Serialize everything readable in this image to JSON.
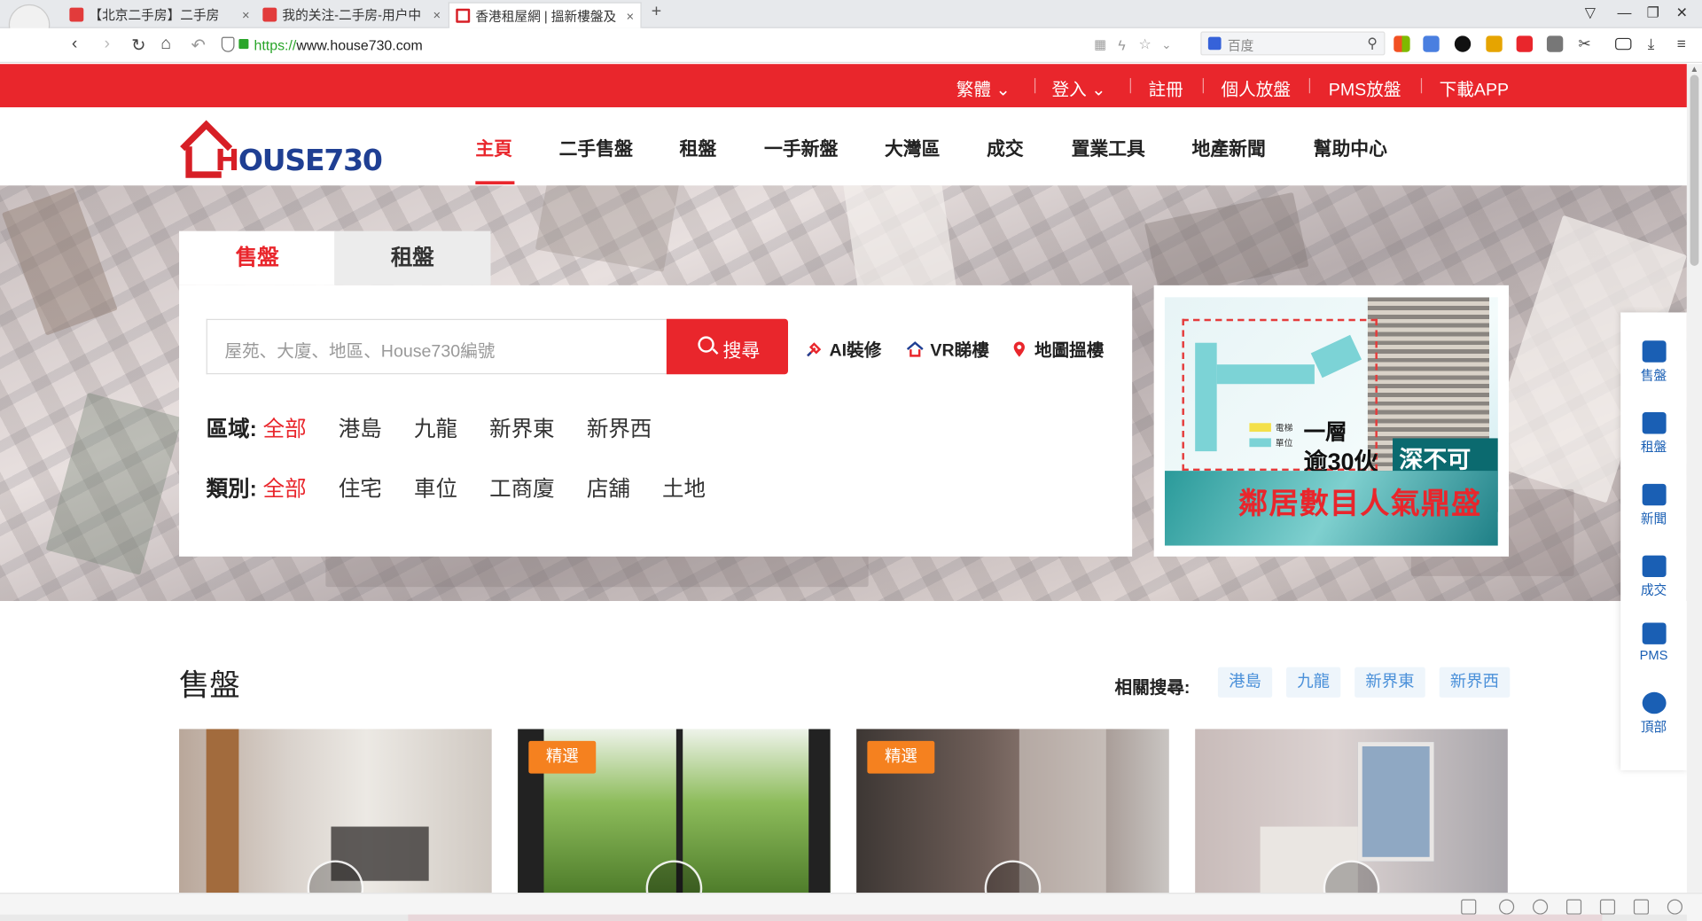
{
  "browser": {
    "tabs": [
      {
        "title": "【北京二手房】二手房",
        "active": false
      },
      {
        "title": "我的关注-二手房-用户中",
        "active": false
      },
      {
        "title": "香港租屋網 | 搵新樓盤及",
        "active": true
      }
    ],
    "url_scheme": "https://",
    "url_rest": "www.house730.com",
    "search_placeholder": "百度",
    "new_tab": "+"
  },
  "topbar": {
    "lang": "繁體",
    "login": "登入",
    "register": "註冊",
    "personal_listing": "個人放盤",
    "pms_listing": "PMS放盤",
    "download_app": "下載APP"
  },
  "logo": {
    "text_h": "H",
    "text_rest": "OUSE730"
  },
  "nav": {
    "items": [
      "主頁",
      "二手售盤",
      "租盤",
      "一手新盤",
      "大灣區",
      "成交",
      "置業工具",
      "地產新聞",
      "幫助中心"
    ]
  },
  "search": {
    "tab_sale": "售盤",
    "tab_rent": "租盤",
    "placeholder": "屋苑、大廈、地區、House730編號",
    "button": "搜尋",
    "quick_links": [
      "AI裝修",
      "VR睇樓",
      "地圖搵樓"
    ],
    "region_label": "區域:",
    "region_options": [
      "全部",
      "港島",
      "九龍",
      "新界東",
      "新界西"
    ],
    "type_label": "類別:",
    "type_options": [
      "全部",
      "住宅",
      "車位",
      "工商廈",
      "店舖",
      "土地"
    ]
  },
  "ad": {
    "legend_lift": "電梯",
    "legend_unit": "單位",
    "line1": "一層",
    "line2": "逾30伙",
    "line3": "深不可測",
    "line4": "鄰居數目人氣鼎盛"
  },
  "sidebar": {
    "items": [
      "售盤",
      "租盤",
      "新聞",
      "成交",
      "PMS",
      "頂部"
    ]
  },
  "section": {
    "title": "售盤",
    "related_label": "相關搜尋:",
    "related_chips": [
      "港島",
      "九龍",
      "新界東",
      "新界西"
    ],
    "cards": [
      {
        "badge": ""
      },
      {
        "badge": "精選"
      },
      {
        "badge": "精選"
      },
      {
        "badge": ""
      }
    ]
  },
  "colors": {
    "brand_red": "#e9262c",
    "link_blue": "#1a5fb4",
    "badge_orange": "#f5811f",
    "logo_blue": "#1f3f93"
  }
}
